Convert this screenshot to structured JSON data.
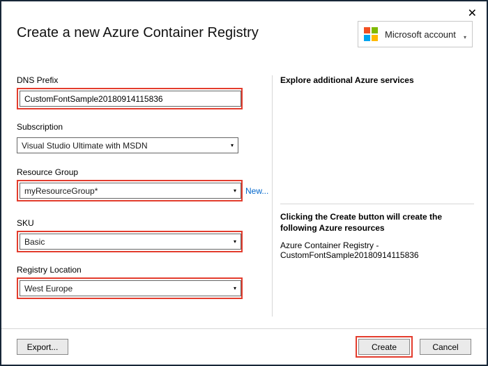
{
  "window": {
    "title": "Create a new Azure Container Registry",
    "account_label": "Microsoft account"
  },
  "form": {
    "dns_prefix": {
      "label": "DNS Prefix",
      "value": "CustomFontSample20180914115836"
    },
    "subscription": {
      "label": "Subscription",
      "value": "Visual Studio Ultimate with MSDN"
    },
    "resource_group": {
      "label": "Resource Group",
      "value": "myResourceGroup*",
      "new_link": "New..."
    },
    "sku": {
      "label": "SKU",
      "value": "Basic"
    },
    "location": {
      "label": "Registry Location",
      "value": "West Europe"
    }
  },
  "right": {
    "heading": "Explore additional Azure services",
    "subheading": "Clicking the Create button will create the following Azure resources",
    "line": "Azure Container Registry - CustomFontSample20180914115836"
  },
  "buttons": {
    "export": "Export...",
    "create": "Create",
    "cancel": "Cancel"
  }
}
